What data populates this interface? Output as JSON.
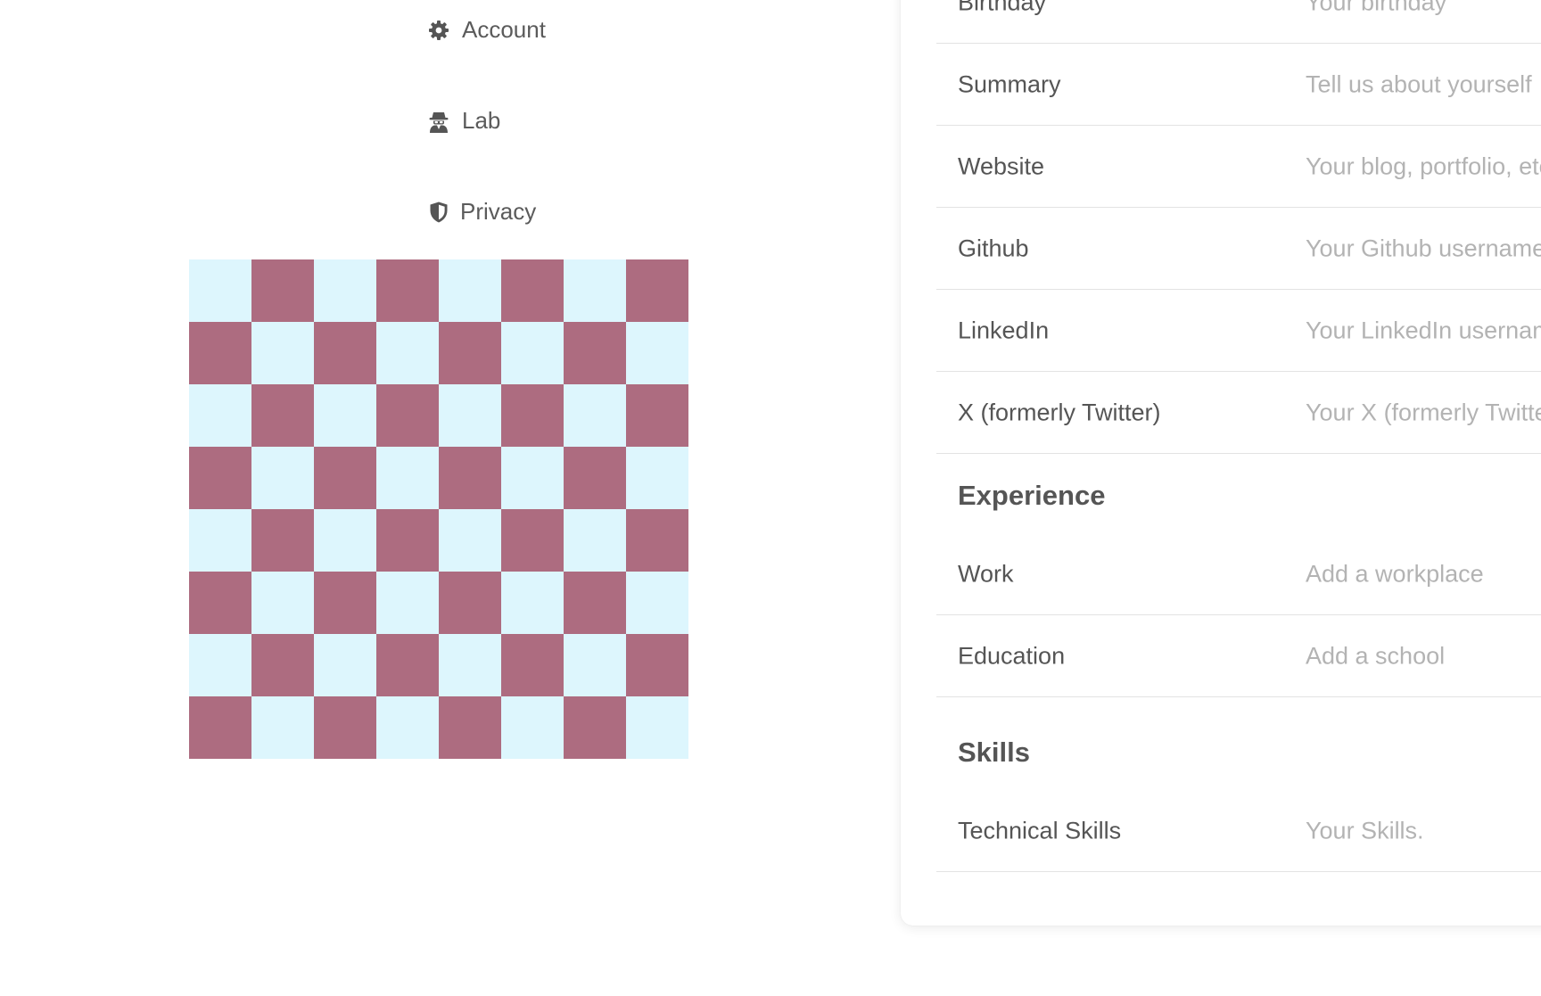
{
  "nav": {
    "items": [
      {
        "label": "Account",
        "icon": "gear-icon"
      },
      {
        "label": "Lab",
        "icon": "spy-icon"
      },
      {
        "label": "Privacy",
        "icon": "shield-icon"
      }
    ]
  },
  "checkerboard": {
    "rows": 8,
    "cols": 8,
    "colors": {
      "light": "#ddf6fd",
      "dark": "#ad6c80"
    }
  },
  "profile": {
    "rows": [
      {
        "label": "Birthday",
        "placeholder": "Your birthday"
      },
      {
        "label": "Summary",
        "placeholder": "Tell us about yourself"
      },
      {
        "label": "Website",
        "placeholder": "Your blog, portfolio, etc."
      },
      {
        "label": "Github",
        "placeholder": "Your Github username"
      },
      {
        "label": "LinkedIn",
        "placeholder": "Your LinkedIn username"
      },
      {
        "label": "X (formerly Twitter)",
        "placeholder": "Your X (formerly Twitter) username"
      }
    ],
    "experience": {
      "title": "Experience",
      "rows": [
        {
          "label": "Work",
          "placeholder": "Add a workplace"
        },
        {
          "label": "Education",
          "placeholder": "Add a school"
        }
      ]
    },
    "skills": {
      "title": "Skills",
      "rows": [
        {
          "label": "Technical Skills",
          "placeholder": "Your Skills."
        }
      ]
    }
  }
}
